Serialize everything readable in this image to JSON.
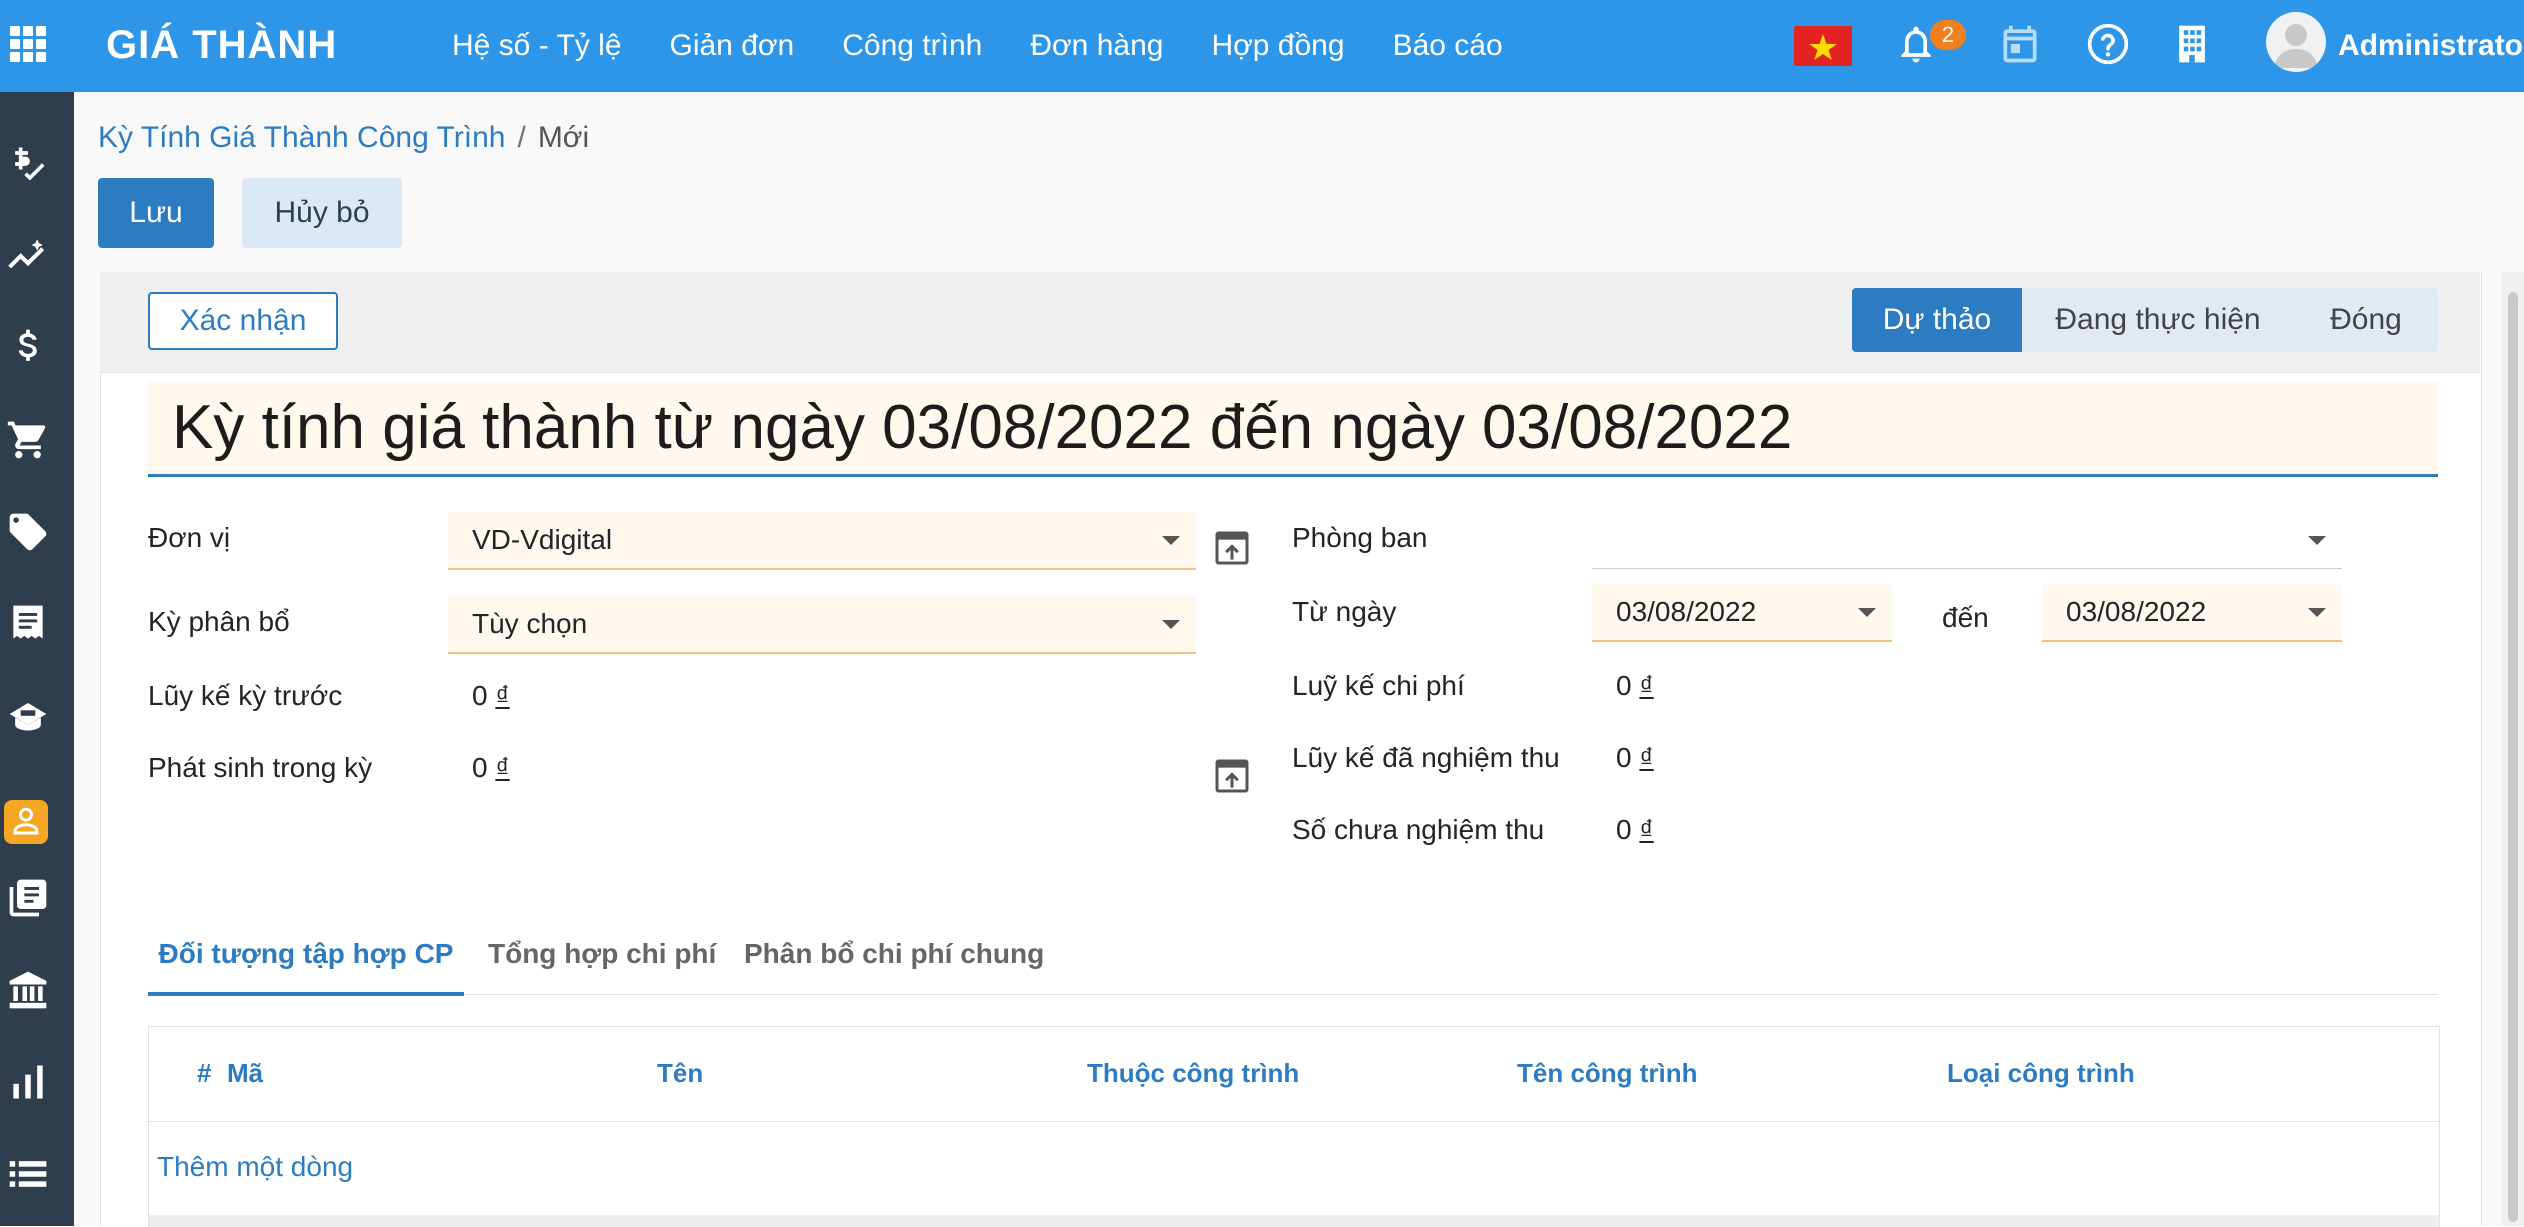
{
  "navbar": {
    "brand": "GIÁ THÀNH",
    "menu": [
      "Hệ số - Tỷ lệ",
      "Giản đơn",
      "Công trình",
      "Đơn hàng",
      "Hợp đồng",
      "Báo cáo"
    ],
    "notification_count": "2",
    "user_name": "Administrator",
    "icons": [
      "apps-icon",
      "vietnam-flag-icon",
      "bell-icon",
      "calendar-icon",
      "help-icon",
      "building-icon",
      "avatar"
    ]
  },
  "sidebar": {
    "icons": [
      "accounting-check-icon",
      "trend-chart-icon",
      "dollar-icon",
      "cart-icon",
      "tag-icon",
      "invoice-icon",
      "payroll-icon",
      "costing-icon",
      "book-icon",
      "bank-icon",
      "bar-chart-icon",
      "list-icon"
    ]
  },
  "breadcrumb": {
    "parent": "Kỳ Tính Giá Thành Công Trình",
    "separator": "/",
    "current": "Mới"
  },
  "actions": {
    "save": "Lưu",
    "discard": "Hủy bỏ"
  },
  "statusbar": {
    "confirm": "Xác nhận",
    "stages": [
      "Dự thảo",
      "Đang thực hiện",
      "Đóng"
    ],
    "active_stage": "Dự thảo"
  },
  "form": {
    "title": "Kỳ tính giá thành từ ngày 03/08/2022 đến ngày 03/08/2022",
    "left": {
      "unit_label": "Đơn vị",
      "unit_value": "VD-Vdigital",
      "period_label": "Kỳ phân bổ",
      "period_value": "Tùy chọn",
      "prev_cumulative_label": "Lũy kế kỳ trước",
      "prev_cumulative_value": "0",
      "in_period_label": "Phát sinh trong kỳ",
      "in_period_value": "0"
    },
    "right": {
      "department_label": "Phòng ban",
      "department_value": "",
      "from_label": "Từ ngày",
      "from_value": "03/08/2022",
      "to_label": "đến",
      "to_value": "03/08/2022",
      "cost_cumulative_label": "Luỹ kế chi phí",
      "cost_cumulative_value": "0",
      "accepted_cumulative_label": "Lũy kế đã nghiệm thu",
      "accepted_cumulative_value": "0",
      "not_accepted_label": "Số chưa nghiệm thu",
      "not_accepted_value": "0"
    },
    "currency_symbol": "₫"
  },
  "tabs": [
    "Đối tượng tập hợp CP",
    "Tổng hợp chi phí",
    "Phân bổ chi phí chung"
  ],
  "table": {
    "columns": [
      "#",
      "Mã",
      "Tên",
      "Thuộc công trình",
      "Tên công trình",
      "Loại công trình"
    ],
    "rows": [],
    "add_line": "Thêm một dòng"
  },
  "colors": {
    "navbar": "#2d96e8",
    "sidebar": "#2f3e4d",
    "primary": "#2d7cc1",
    "required_field": "#fff8ee",
    "badge": "#f07f1d"
  }
}
